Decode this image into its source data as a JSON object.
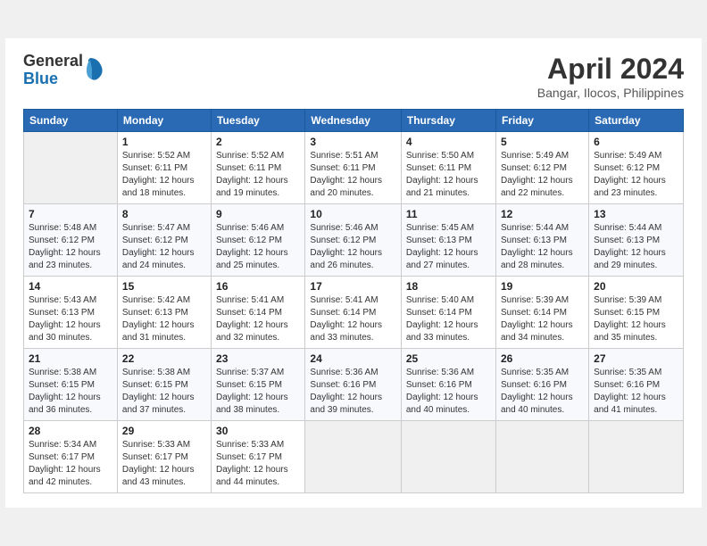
{
  "logo": {
    "general": "General",
    "blue": "Blue"
  },
  "title": "April 2024",
  "location": "Bangar, Ilocos, Philippines",
  "days_header": [
    "Sunday",
    "Monday",
    "Tuesday",
    "Wednesday",
    "Thursday",
    "Friday",
    "Saturday"
  ],
  "weeks": [
    [
      {
        "day": "",
        "sunrise": "",
        "sunset": "",
        "daylight": ""
      },
      {
        "day": "1",
        "sunrise": "Sunrise: 5:52 AM",
        "sunset": "Sunset: 6:11 PM",
        "daylight": "Daylight: 12 hours and 18 minutes."
      },
      {
        "day": "2",
        "sunrise": "Sunrise: 5:52 AM",
        "sunset": "Sunset: 6:11 PM",
        "daylight": "Daylight: 12 hours and 19 minutes."
      },
      {
        "day": "3",
        "sunrise": "Sunrise: 5:51 AM",
        "sunset": "Sunset: 6:11 PM",
        "daylight": "Daylight: 12 hours and 20 minutes."
      },
      {
        "day": "4",
        "sunrise": "Sunrise: 5:50 AM",
        "sunset": "Sunset: 6:11 PM",
        "daylight": "Daylight: 12 hours and 21 minutes."
      },
      {
        "day": "5",
        "sunrise": "Sunrise: 5:49 AM",
        "sunset": "Sunset: 6:12 PM",
        "daylight": "Daylight: 12 hours and 22 minutes."
      },
      {
        "day": "6",
        "sunrise": "Sunrise: 5:49 AM",
        "sunset": "Sunset: 6:12 PM",
        "daylight": "Daylight: 12 hours and 23 minutes."
      }
    ],
    [
      {
        "day": "7",
        "sunrise": "Sunrise: 5:48 AM",
        "sunset": "Sunset: 6:12 PM",
        "daylight": "Daylight: 12 hours and 23 minutes."
      },
      {
        "day": "8",
        "sunrise": "Sunrise: 5:47 AM",
        "sunset": "Sunset: 6:12 PM",
        "daylight": "Daylight: 12 hours and 24 minutes."
      },
      {
        "day": "9",
        "sunrise": "Sunrise: 5:46 AM",
        "sunset": "Sunset: 6:12 PM",
        "daylight": "Daylight: 12 hours and 25 minutes."
      },
      {
        "day": "10",
        "sunrise": "Sunrise: 5:46 AM",
        "sunset": "Sunset: 6:12 PM",
        "daylight": "Daylight: 12 hours and 26 minutes."
      },
      {
        "day": "11",
        "sunrise": "Sunrise: 5:45 AM",
        "sunset": "Sunset: 6:13 PM",
        "daylight": "Daylight: 12 hours and 27 minutes."
      },
      {
        "day": "12",
        "sunrise": "Sunrise: 5:44 AM",
        "sunset": "Sunset: 6:13 PM",
        "daylight": "Daylight: 12 hours and 28 minutes."
      },
      {
        "day": "13",
        "sunrise": "Sunrise: 5:44 AM",
        "sunset": "Sunset: 6:13 PM",
        "daylight": "Daylight: 12 hours and 29 minutes."
      }
    ],
    [
      {
        "day": "14",
        "sunrise": "Sunrise: 5:43 AM",
        "sunset": "Sunset: 6:13 PM",
        "daylight": "Daylight: 12 hours and 30 minutes."
      },
      {
        "day": "15",
        "sunrise": "Sunrise: 5:42 AM",
        "sunset": "Sunset: 6:13 PM",
        "daylight": "Daylight: 12 hours and 31 minutes."
      },
      {
        "day": "16",
        "sunrise": "Sunrise: 5:41 AM",
        "sunset": "Sunset: 6:14 PM",
        "daylight": "Daylight: 12 hours and 32 minutes."
      },
      {
        "day": "17",
        "sunrise": "Sunrise: 5:41 AM",
        "sunset": "Sunset: 6:14 PM",
        "daylight": "Daylight: 12 hours and 33 minutes."
      },
      {
        "day": "18",
        "sunrise": "Sunrise: 5:40 AM",
        "sunset": "Sunset: 6:14 PM",
        "daylight": "Daylight: 12 hours and 33 minutes."
      },
      {
        "day": "19",
        "sunrise": "Sunrise: 5:39 AM",
        "sunset": "Sunset: 6:14 PM",
        "daylight": "Daylight: 12 hours and 34 minutes."
      },
      {
        "day": "20",
        "sunrise": "Sunrise: 5:39 AM",
        "sunset": "Sunset: 6:15 PM",
        "daylight": "Daylight: 12 hours and 35 minutes."
      }
    ],
    [
      {
        "day": "21",
        "sunrise": "Sunrise: 5:38 AM",
        "sunset": "Sunset: 6:15 PM",
        "daylight": "Daylight: 12 hours and 36 minutes."
      },
      {
        "day": "22",
        "sunrise": "Sunrise: 5:38 AM",
        "sunset": "Sunset: 6:15 PM",
        "daylight": "Daylight: 12 hours and 37 minutes."
      },
      {
        "day": "23",
        "sunrise": "Sunrise: 5:37 AM",
        "sunset": "Sunset: 6:15 PM",
        "daylight": "Daylight: 12 hours and 38 minutes."
      },
      {
        "day": "24",
        "sunrise": "Sunrise: 5:36 AM",
        "sunset": "Sunset: 6:16 PM",
        "daylight": "Daylight: 12 hours and 39 minutes."
      },
      {
        "day": "25",
        "sunrise": "Sunrise: 5:36 AM",
        "sunset": "Sunset: 6:16 PM",
        "daylight": "Daylight: 12 hours and 40 minutes."
      },
      {
        "day": "26",
        "sunrise": "Sunrise: 5:35 AM",
        "sunset": "Sunset: 6:16 PM",
        "daylight": "Daylight: 12 hours and 40 minutes."
      },
      {
        "day": "27",
        "sunrise": "Sunrise: 5:35 AM",
        "sunset": "Sunset: 6:16 PM",
        "daylight": "Daylight: 12 hours and 41 minutes."
      }
    ],
    [
      {
        "day": "28",
        "sunrise": "Sunrise: 5:34 AM",
        "sunset": "Sunset: 6:17 PM",
        "daylight": "Daylight: 12 hours and 42 minutes."
      },
      {
        "day": "29",
        "sunrise": "Sunrise: 5:33 AM",
        "sunset": "Sunset: 6:17 PM",
        "daylight": "Daylight: 12 hours and 43 minutes."
      },
      {
        "day": "30",
        "sunrise": "Sunrise: 5:33 AM",
        "sunset": "Sunset: 6:17 PM",
        "daylight": "Daylight: 12 hours and 44 minutes."
      },
      {
        "day": "",
        "sunrise": "",
        "sunset": "",
        "daylight": ""
      },
      {
        "day": "",
        "sunrise": "",
        "sunset": "",
        "daylight": ""
      },
      {
        "day": "",
        "sunrise": "",
        "sunset": "",
        "daylight": ""
      },
      {
        "day": "",
        "sunrise": "",
        "sunset": "",
        "daylight": ""
      }
    ]
  ]
}
